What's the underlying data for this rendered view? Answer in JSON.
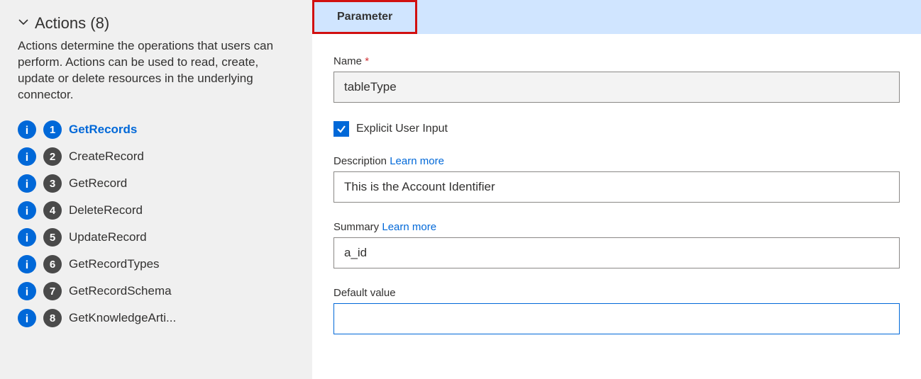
{
  "sidebar": {
    "title": "Actions (8)",
    "description": "Actions determine the operations that users can perform. Actions can be used to read, create, update or delete resources in the underlying connector.",
    "items": [
      {
        "num": "1",
        "label": "GetRecords",
        "selected": true
      },
      {
        "num": "2",
        "label": "CreateRecord",
        "selected": false
      },
      {
        "num": "3",
        "label": "GetRecord",
        "selected": false
      },
      {
        "num": "4",
        "label": "DeleteRecord",
        "selected": false
      },
      {
        "num": "5",
        "label": "UpdateRecord",
        "selected": false
      },
      {
        "num": "6",
        "label": "GetRecordTypes",
        "selected": false
      },
      {
        "num": "7",
        "label": "GetRecordSchema",
        "selected": false
      },
      {
        "num": "8",
        "label": "GetKnowledgeArti...",
        "selected": false
      }
    ]
  },
  "tab": {
    "label": "Parameter"
  },
  "form": {
    "name_label": "Name",
    "name_value": "tableType",
    "explicit_label": "Explicit User Input",
    "description_label": "Description",
    "description_value": "This is the Account Identifier",
    "summary_label": "Summary",
    "summary_value": "a_id",
    "default_label": "Default value",
    "default_value": "",
    "learn_more": "Learn more"
  }
}
